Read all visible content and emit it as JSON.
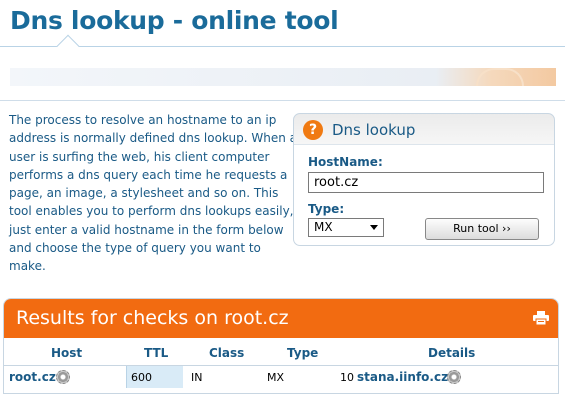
{
  "page": {
    "title": "Dns lookup - online tool"
  },
  "intro": {
    "text": "The process to resolve an hostname to an ip address is normally defined dns lookup. When a user is surfing the web, his client computer performs a dns query each time he requests a page, an image, a stylesheet and so on. This tool enables you to perform dns lookups easily, just enter a valid hostname in the form below and choose the type of query you want to make."
  },
  "lookup": {
    "title": "Dns lookup",
    "help_glyph": "?",
    "hostname_label": "HostName:",
    "hostname_value": "root.cz",
    "type_label": "Type:",
    "type_value": "MX",
    "run_label": "Run tool ››"
  },
  "results": {
    "title": "Results for checks on root.cz",
    "columns": [
      "Host",
      "TTL",
      "Class",
      "Type",
      "Details"
    ],
    "rows": [
      {
        "host": "root.cz",
        "ttl": "600",
        "class": "IN",
        "type": "MX",
        "priority": "10",
        "target": "stana.iinfo.cz"
      }
    ]
  },
  "colors": {
    "accent": "#f26b11",
    "text": "#1a5a86",
    "ttl_highlight": "#d9ebf7"
  },
  "icons": [
    "help-icon",
    "printer-icon",
    "gear-icon"
  ]
}
